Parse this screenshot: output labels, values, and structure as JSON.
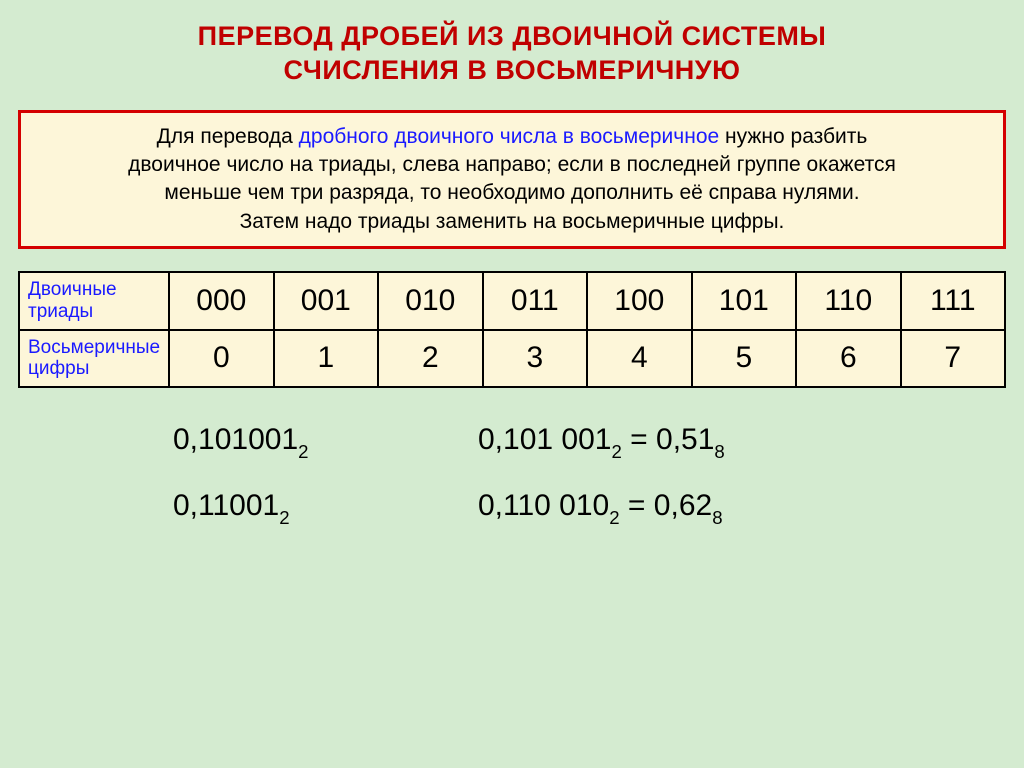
{
  "title_line1": "ПЕРЕВОД ДРОБЕЙ ИЗ ДВОИЧНОЙ СИСТЕМЫ",
  "title_line2": "СЧИСЛЕНИЯ В ВОСЬМЕРИЧНУЮ",
  "rule": {
    "p1a": "Для перевода ",
    "p1b": "дробного двоичного числа в восьмеричное",
    "p1c": " нужно разбить",
    "p2": "двоичное число на триады, слева направо; если в последней группе окажется",
    "p3": "меньше чем три разряда, то необходимо дополнить её справа нулями.",
    "p4": "Затем надо триады заменить на восьмеричные цифры."
  },
  "table": {
    "row1_label": "Двоичные триады",
    "row2_label": "Восьмеричные цифры",
    "triads": [
      "000",
      "001",
      "010",
      "011",
      "100",
      "101",
      "110",
      "111"
    ],
    "octs": [
      "0",
      "1",
      "2",
      "3",
      "4",
      "5",
      "6",
      "7"
    ]
  },
  "examples": {
    "e1_left_main": "0,101001",
    "e1_left_sub": "2",
    "e1_right_a": "0,101 001",
    "e1_right_a_sub": "2",
    "e1_right_eq": " = ",
    "e1_right_b": "0,51",
    "e1_right_b_sub": "8",
    "e2_left_main": "0,11001",
    "e2_left_sub": "2",
    "e2_right_a": "0,110 010",
    "e2_right_a_sub": "2",
    "e2_right_eq": " = ",
    "e2_right_b": "0,62",
    "e2_right_b_sub": "8"
  }
}
